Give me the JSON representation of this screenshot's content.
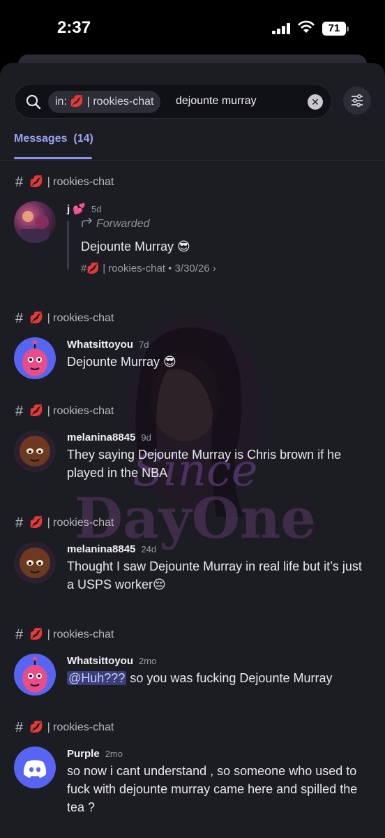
{
  "status": {
    "time": "2:37",
    "battery": "71"
  },
  "search": {
    "chip_prefix": "in:",
    "chip_channel": "| rookies-chat",
    "query": "dejounte murray"
  },
  "tabs": {
    "messages_label": "Messages",
    "messages_count": "(14)"
  },
  "channel_name": "| rookies-chat",
  "results": [
    {
      "username": "j 💕",
      "time": "5d",
      "forwarded_label": "Forwarded",
      "text": "Dejounte Murray 😎",
      "source_channel": "| rookies-chat • 3/30/26 ›"
    },
    {
      "username": "Whatsittoyou",
      "time": "7d",
      "text": "Dejounte Murray 😎"
    },
    {
      "username": "melanina8845",
      "time": "9d",
      "text": "They saying Dejounte Murray is Chris brown if he played in the NBA"
    },
    {
      "username": "melanina8845",
      "time": "24d",
      "text": "Thought I saw Dejounte Murray in real life but it’s just a USPS worker😔"
    },
    {
      "username": "Whatsittoyou",
      "time": "2mo",
      "mention": "@Huh???",
      "text": " so you was fucking Dejounte Murray"
    },
    {
      "username": "Purple",
      "time": "2mo",
      "text": "so  now i cant understand , so someone who used to fuck with dejounte murray came here and spilled the tea ?"
    }
  ],
  "watermark": {
    "line1": "Since",
    "line2": "DayOne"
  },
  "colors": {
    "accent": "#9aa3f5",
    "background": "#1c1d22",
    "mention_bg": "#3a3f7a"
  }
}
